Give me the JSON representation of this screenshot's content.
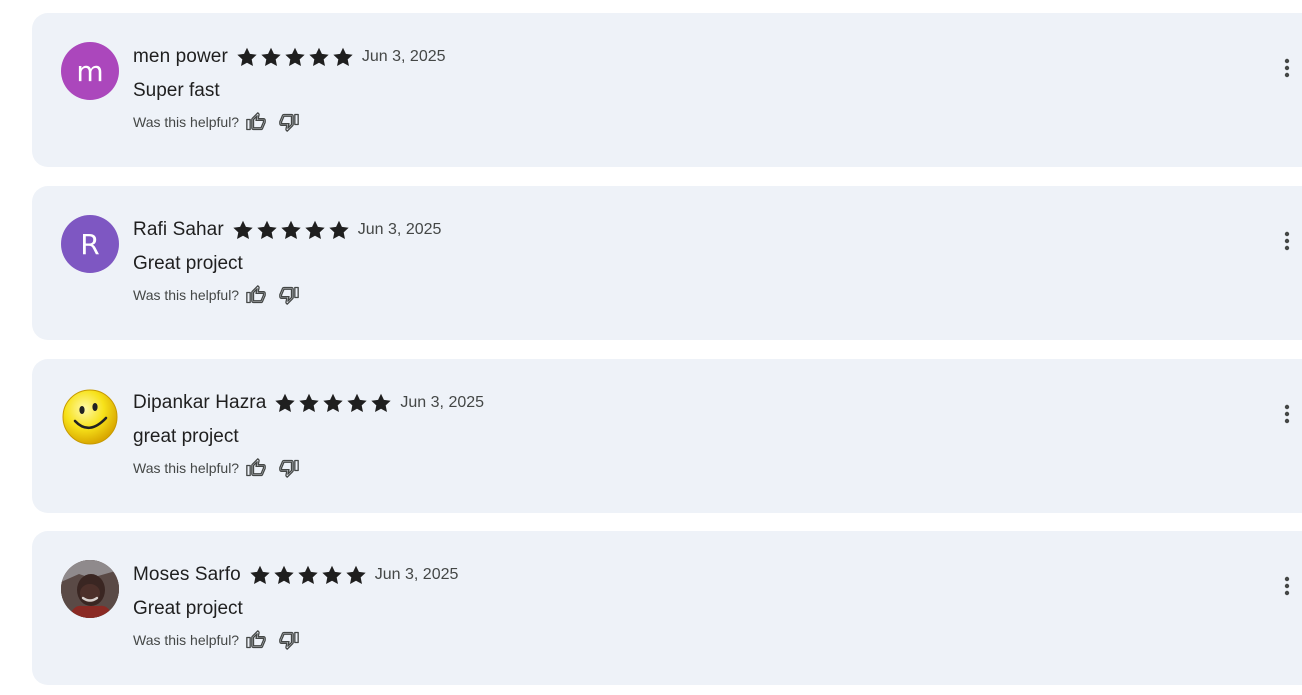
{
  "colors": {
    "card_background": "#eef2f8",
    "star": "#1f1f1f",
    "avatar_m": "#ab47bc",
    "avatar_r": "#7e57c2",
    "text_secondary": "#444746"
  },
  "reviews": [
    {
      "author": "men power",
      "avatar_type": "initial",
      "avatar_initial": "m",
      "avatar_color": "#ab47bc",
      "rating": 5,
      "date": "Jun 3, 2025",
      "text": "Super fast",
      "helpful_label": "Was this helpful?",
      "thumbs_up_icon": "thumbs-up-icon",
      "thumbs_down_icon": "thumbs-down-icon",
      "more_icon": "more-vert-icon"
    },
    {
      "author": "Rafi Sahar",
      "avatar_type": "initial",
      "avatar_initial": "R",
      "avatar_color": "#7e57c2",
      "rating": 5,
      "date": "Jun 3, 2025",
      "text": "Great project",
      "helpful_label": "Was this helpful?",
      "thumbs_up_icon": "thumbs-up-icon",
      "thumbs_down_icon": "thumbs-down-icon",
      "more_icon": "more-vert-icon"
    },
    {
      "author": "Dipankar Hazra",
      "avatar_type": "smiley-photo",
      "rating": 5,
      "date": "Jun 3, 2025",
      "text": "great project",
      "helpful_label": "Was this helpful?",
      "thumbs_up_icon": "thumbs-up-icon",
      "thumbs_down_icon": "thumbs-down-icon",
      "more_icon": "more-vert-icon"
    },
    {
      "author": "Moses Sarfo",
      "avatar_type": "person-photo",
      "rating": 5,
      "date": "Jun 3, 2025",
      "text": "Great project",
      "helpful_label": "Was this helpful?",
      "thumbs_up_icon": "thumbs-up-icon",
      "thumbs_down_icon": "thumbs-down-icon",
      "more_icon": "more-vert-icon"
    }
  ]
}
